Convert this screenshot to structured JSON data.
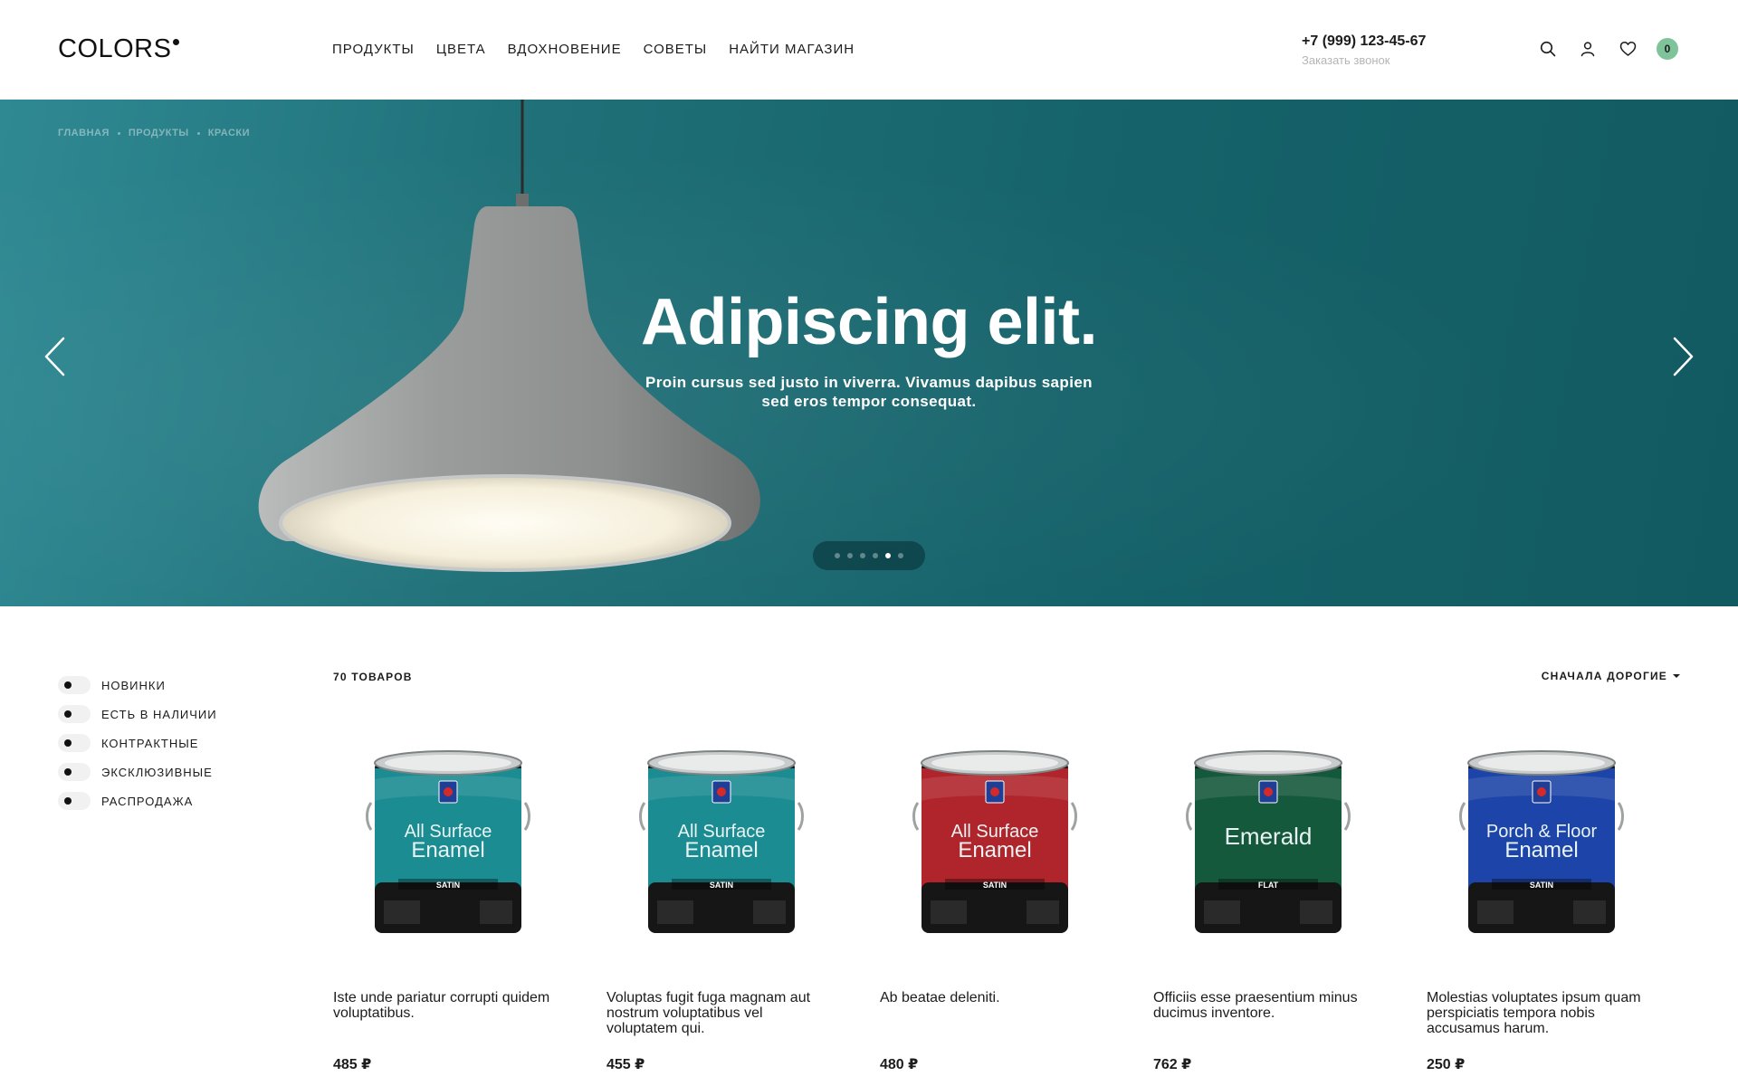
{
  "header": {
    "logo": "COLORS",
    "nav": [
      "ПРОДУКТЫ",
      "ЦВЕТА",
      "ВДОХНОВЕНИЕ",
      "СОВЕТЫ",
      "НАЙТИ МАГАЗИН"
    ],
    "phone": "+7 (999) 123-45-67",
    "callback": "Заказать звонок",
    "icons": [
      "search-icon",
      "user-icon",
      "heart-icon",
      "cart-icon"
    ],
    "cart_count": "0"
  },
  "hero": {
    "breadcrumbs": [
      "ГЛАВНАЯ",
      "ПРОДУКТЫ",
      "КРАСКИ"
    ],
    "title": "Adipiscing elit.",
    "subtitle": "Proin cursus sed justo in viverra. Vivamus dapibus sapien sed eros tempor consequat.",
    "slides_total": 6,
    "active_slide": 5
  },
  "filters": [
    "НОВИНКИ",
    "ЕСТЬ В НАЛИЧИИ",
    "КОНТРАКТНЫЕ",
    "ЭКСКЛЮЗИВНЫЕ",
    "РАСПРОДАЖА"
  ],
  "listing": {
    "count": "70 ТОВАРОВ",
    "sort": "СНАЧАЛА ДОРОГИЕ"
  },
  "products": [
    {
      "name": "Iste unde pariatur corrupti quidem voluptatibus.",
      "price": "485 ₽",
      "can": {
        "line1": "All Surface",
        "line2": "Enamel",
        "finish": "SATIN",
        "color": "#1b8c92"
      }
    },
    {
      "name": "Voluptas fugit fuga magnam aut nostrum voluptatibus vel voluptatem qui.",
      "price": "455 ₽",
      "can": {
        "line1": "All Surface",
        "line2": "Enamel",
        "finish": "SATIN",
        "color": "#1b8c92"
      }
    },
    {
      "name": "Ab beatae deleniti.",
      "price": "480 ₽",
      "can": {
        "line1": "All Surface",
        "line2": "Enamel",
        "finish": "SATIN",
        "color": "#b0252c"
      }
    },
    {
      "name": "Officiis esse praesentium minus ducimus inventore.",
      "price": "762 ₽",
      "can": {
        "line1": "Emerald",
        "line2": "",
        "finish": "FLAT",
        "color": "#15593c"
      }
    },
    {
      "name": "Molestias voluptates ipsum quam perspiciatis tempora nobis accusamus harum.",
      "price": "250 ₽",
      "can": {
        "line1": "Porch & Floor",
        "line2": "Enamel",
        "finish": "SATIN",
        "color": "#1d44a8"
      }
    }
  ],
  "colors": {
    "hero_bg": "#1b6c74",
    "accent_badge": "#7fc39a",
    "text": "#1c1c1c"
  }
}
